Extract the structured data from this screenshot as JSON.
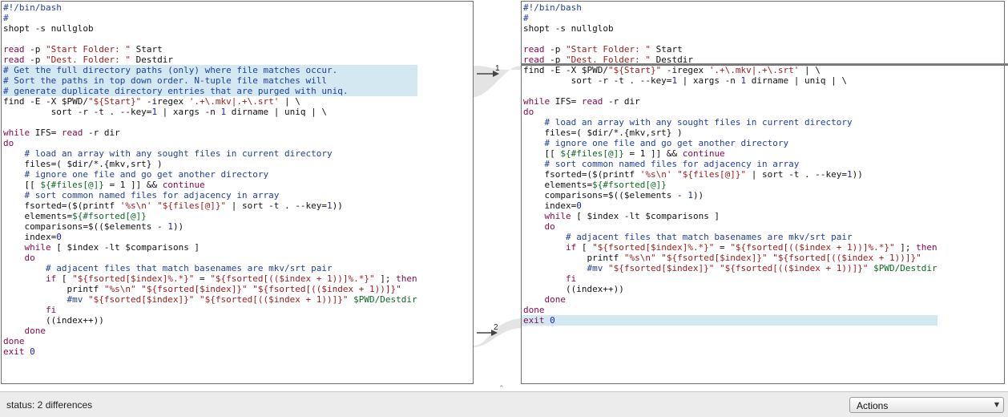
{
  "left": {
    "lines": [
      {
        "hl": false,
        "tokens": [
          {
            "t": "comment",
            "v": "#!/bin/bash"
          }
        ]
      },
      {
        "hl": false,
        "tokens": [
          {
            "t": "comment",
            "v": "#"
          }
        ]
      },
      {
        "hl": false,
        "tokens": [
          {
            "t": "plain",
            "v": "shopt -s nullglob"
          }
        ]
      },
      {
        "hl": false,
        "tokens": []
      },
      {
        "hl": false,
        "tokens": [
          {
            "t": "keyword",
            "v": "read"
          },
          {
            "t": "plain",
            "v": " -p "
          },
          {
            "t": "string",
            "v": "\"Start Folder: \""
          },
          {
            "t": "plain",
            "v": " Start"
          }
        ]
      },
      {
        "hl": false,
        "tokens": [
          {
            "t": "keyword",
            "v": "read"
          },
          {
            "t": "plain",
            "v": " -p "
          },
          {
            "t": "string",
            "v": "\"Dest. Folder: \""
          },
          {
            "t": "plain",
            "v": " Destdir"
          }
        ]
      },
      {
        "hl": true,
        "tokens": [
          {
            "t": "comment",
            "v": "# Get the full directory paths (only) where file matches occur."
          }
        ]
      },
      {
        "hl": true,
        "tokens": [
          {
            "t": "comment",
            "v": "# Sort the paths in top down order. N-tuple file matches will"
          }
        ]
      },
      {
        "hl": true,
        "tokens": [
          {
            "t": "comment",
            "v": "# generate duplicate directory entries that are purged with uniq."
          }
        ]
      },
      {
        "hl": false,
        "tokens": [
          {
            "t": "plain",
            "v": "find -E -X $PWD/"
          },
          {
            "t": "string",
            "v": "\"${Start}\""
          },
          {
            "t": "plain",
            "v": " -iregex "
          },
          {
            "t": "string",
            "v": "'.+\\.mkv|.+\\.srt'"
          },
          {
            "t": "plain",
            "v": " | \\"
          }
        ]
      },
      {
        "hl": false,
        "tokens": [
          {
            "t": "plain",
            "v": "         sort -r -t . --key="
          },
          {
            "t": "num",
            "v": "1"
          },
          {
            "t": "plain",
            "v": " | xargs -n "
          },
          {
            "t": "num",
            "v": "1"
          },
          {
            "t": "plain",
            "v": " dirname | uniq | \\"
          }
        ]
      },
      {
        "hl": false,
        "tokens": []
      },
      {
        "hl": false,
        "tokens": [
          {
            "t": "keyword",
            "v": "while"
          },
          {
            "t": "plain",
            "v": " IFS= "
          },
          {
            "t": "keyword",
            "v": "read"
          },
          {
            "t": "plain",
            "v": " -r dir"
          }
        ]
      },
      {
        "hl": false,
        "tokens": [
          {
            "t": "keyword",
            "v": "do"
          }
        ]
      },
      {
        "hl": false,
        "tokens": [
          {
            "t": "comment",
            "v": "    # load an array with any sought files in current directory"
          }
        ]
      },
      {
        "hl": false,
        "tokens": [
          {
            "t": "plain",
            "v": "    files=( $dir/*.{mkv,srt} )"
          }
        ]
      },
      {
        "hl": false,
        "tokens": [
          {
            "t": "comment",
            "v": "    # ignore one file and go get another directory"
          }
        ]
      },
      {
        "hl": false,
        "tokens": [
          {
            "t": "plain",
            "v": "    [[ "
          },
          {
            "t": "var",
            "v": "${#files[@]}"
          },
          {
            "t": "plain",
            "v": " = 1 ]] && "
          },
          {
            "t": "keyword",
            "v": "continue"
          }
        ]
      },
      {
        "hl": false,
        "tokens": [
          {
            "t": "comment",
            "v": "    # sort common named files for adjacency in array"
          }
        ]
      },
      {
        "hl": false,
        "tokens": [
          {
            "t": "plain",
            "v": "    fsorted=($(printf "
          },
          {
            "t": "string",
            "v": "'%s\\n'"
          },
          {
            "t": "plain",
            "v": " "
          },
          {
            "t": "string",
            "v": "\"${files[@]}\""
          },
          {
            "t": "plain",
            "v": " | sort -t . --key="
          },
          {
            "t": "num",
            "v": "1"
          },
          {
            "t": "plain",
            "v": "))"
          }
        ]
      },
      {
        "hl": false,
        "tokens": [
          {
            "t": "plain",
            "v": "    elements="
          },
          {
            "t": "var",
            "v": "${#fsorted[@]}"
          }
        ]
      },
      {
        "hl": false,
        "tokens": [
          {
            "t": "plain",
            "v": "    comparisons=$(($elements - "
          },
          {
            "t": "num",
            "v": "1"
          },
          {
            "t": "plain",
            "v": "))"
          }
        ]
      },
      {
        "hl": false,
        "tokens": [
          {
            "t": "plain",
            "v": "    index="
          },
          {
            "t": "num",
            "v": "0"
          }
        ]
      },
      {
        "hl": false,
        "tokens": [
          {
            "t": "plain",
            "v": "    "
          },
          {
            "t": "keyword",
            "v": "while"
          },
          {
            "t": "plain",
            "v": " [ $index -lt $comparisons ]"
          }
        ]
      },
      {
        "hl": false,
        "tokens": [
          {
            "t": "plain",
            "v": "    "
          },
          {
            "t": "keyword",
            "v": "do"
          }
        ]
      },
      {
        "hl": false,
        "tokens": [
          {
            "t": "comment",
            "v": "        # adjacent files that match basenames are mkv/srt pair"
          }
        ]
      },
      {
        "hl": false,
        "tokens": [
          {
            "t": "plain",
            "v": "        "
          },
          {
            "t": "keyword",
            "v": "if"
          },
          {
            "t": "plain",
            "v": " [ "
          },
          {
            "t": "string",
            "v": "\"${fsorted[$index]%.*}\""
          },
          {
            "t": "plain",
            "v": " = "
          },
          {
            "t": "string",
            "v": "\"${fsorted[(($index + 1))]%.*}\""
          },
          {
            "t": "plain",
            "v": " ]; "
          },
          {
            "t": "keyword",
            "v": "then"
          }
        ]
      },
      {
        "hl": false,
        "tokens": [
          {
            "t": "plain",
            "v": "            printf "
          },
          {
            "t": "string",
            "v": "\"%s\\n\""
          },
          {
            "t": "plain",
            "v": " "
          },
          {
            "t": "string",
            "v": "\"${fsorted[$index]}\""
          },
          {
            "t": "plain",
            "v": " "
          },
          {
            "t": "string",
            "v": "\"${fsorted[(($index + 1))]}\""
          }
        ]
      },
      {
        "hl": false,
        "tokens": [
          {
            "t": "comment",
            "v": "            #mv "
          },
          {
            "t": "string",
            "v": "\"${fsorted[$index]}\""
          },
          {
            "t": "plain",
            "v": " "
          },
          {
            "t": "string",
            "v": "\"${fsorted[(($index + 1))]}\""
          },
          {
            "t": "plain",
            "v": " "
          },
          {
            "t": "var",
            "v": "$PWD/Destdir"
          }
        ]
      },
      {
        "hl": false,
        "tokens": [
          {
            "t": "keyword",
            "v": "        fi"
          }
        ]
      },
      {
        "hl": false,
        "tokens": [
          {
            "t": "plain",
            "v": "        ((index++))"
          }
        ]
      },
      {
        "hl": false,
        "tokens": [
          {
            "t": "keyword",
            "v": "    done"
          }
        ]
      },
      {
        "hl": false,
        "tokens": [
          {
            "t": "keyword",
            "v": "done"
          }
        ]
      },
      {
        "hl": false,
        "tokens": [
          {
            "t": "keyword",
            "v": "exit"
          },
          {
            "t": "plain",
            "v": " "
          },
          {
            "t": "num",
            "v": "0"
          }
        ]
      }
    ]
  },
  "right": {
    "lines": [
      {
        "hl": false,
        "tokens": [
          {
            "t": "comment",
            "v": "#!/bin/bash"
          }
        ]
      },
      {
        "hl": false,
        "tokens": [
          {
            "t": "comment",
            "v": "#"
          }
        ]
      },
      {
        "hl": false,
        "tokens": [
          {
            "t": "plain",
            "v": "shopt -s nullglob"
          }
        ]
      },
      {
        "hl": false,
        "tokens": []
      },
      {
        "hl": false,
        "tokens": [
          {
            "t": "keyword",
            "v": "read"
          },
          {
            "t": "plain",
            "v": " -p "
          },
          {
            "t": "string",
            "v": "\"Start Folder: \""
          },
          {
            "t": "plain",
            "v": " Start"
          }
        ]
      },
      {
        "hl": false,
        "tokens": [
          {
            "t": "keyword",
            "v": "read"
          },
          {
            "t": "plain",
            "v": " -p "
          },
          {
            "t": "string",
            "v": "\"Dest. Folder: \""
          },
          {
            "t": "plain",
            "v": " Destdir"
          }
        ]
      },
      {
        "hl": false,
        "tokens": [
          {
            "t": "plain",
            "v": "find -E -X $PWD/"
          },
          {
            "t": "string",
            "v": "\"${Start}\""
          },
          {
            "t": "plain",
            "v": " -iregex "
          },
          {
            "t": "string",
            "v": "'.+\\.mkv|.+\\.srt'"
          },
          {
            "t": "plain",
            "v": " | \\"
          }
        ]
      },
      {
        "hl": false,
        "tokens": [
          {
            "t": "plain",
            "v": "         sort -r -t . --key="
          },
          {
            "t": "num",
            "v": "1"
          },
          {
            "t": "plain",
            "v": " | xargs -n "
          },
          {
            "t": "num",
            "v": "1"
          },
          {
            "t": "plain",
            "v": " dirname | uniq | \\"
          }
        ]
      },
      {
        "hl": false,
        "tokens": []
      },
      {
        "hl": false,
        "tokens": [
          {
            "t": "keyword",
            "v": "while"
          },
          {
            "t": "plain",
            "v": " IFS= "
          },
          {
            "t": "keyword",
            "v": "read"
          },
          {
            "t": "plain",
            "v": " -r dir"
          }
        ]
      },
      {
        "hl": false,
        "tokens": [
          {
            "t": "keyword",
            "v": "do"
          }
        ]
      },
      {
        "hl": false,
        "tokens": [
          {
            "t": "comment",
            "v": "    # load an array with any sought files in current directory"
          }
        ]
      },
      {
        "hl": false,
        "tokens": [
          {
            "t": "plain",
            "v": "    files=( $dir/*.{mkv,srt} )"
          }
        ]
      },
      {
        "hl": false,
        "tokens": [
          {
            "t": "comment",
            "v": "    # ignore one file and go get another directory"
          }
        ]
      },
      {
        "hl": false,
        "tokens": [
          {
            "t": "plain",
            "v": "    [[ "
          },
          {
            "t": "var",
            "v": "${#files[@]}"
          },
          {
            "t": "plain",
            "v": " = 1 ]] && "
          },
          {
            "t": "keyword",
            "v": "continue"
          }
        ]
      },
      {
        "hl": false,
        "tokens": [
          {
            "t": "comment",
            "v": "    # sort common named files for adjacency in array"
          }
        ]
      },
      {
        "hl": false,
        "tokens": [
          {
            "t": "plain",
            "v": "    fsorted=($(printf "
          },
          {
            "t": "string",
            "v": "'%s\\n'"
          },
          {
            "t": "plain",
            "v": " "
          },
          {
            "t": "string",
            "v": "\"${files[@]}\""
          },
          {
            "t": "plain",
            "v": " | sort -t . --key="
          },
          {
            "t": "num",
            "v": "1"
          },
          {
            "t": "plain",
            "v": "))"
          }
        ]
      },
      {
        "hl": false,
        "tokens": [
          {
            "t": "plain",
            "v": "    elements="
          },
          {
            "t": "var",
            "v": "${#fsorted[@]}"
          }
        ]
      },
      {
        "hl": false,
        "tokens": [
          {
            "t": "plain",
            "v": "    comparisons=$(($elements - "
          },
          {
            "t": "num",
            "v": "1"
          },
          {
            "t": "plain",
            "v": "))"
          }
        ]
      },
      {
        "hl": false,
        "tokens": [
          {
            "t": "plain",
            "v": "    index="
          },
          {
            "t": "num",
            "v": "0"
          }
        ]
      },
      {
        "hl": false,
        "tokens": [
          {
            "t": "plain",
            "v": "    "
          },
          {
            "t": "keyword",
            "v": "while"
          },
          {
            "t": "plain",
            "v": " [ $index -lt $comparisons ]"
          }
        ]
      },
      {
        "hl": false,
        "tokens": [
          {
            "t": "plain",
            "v": "    "
          },
          {
            "t": "keyword",
            "v": "do"
          }
        ]
      },
      {
        "hl": false,
        "tokens": [
          {
            "t": "comment",
            "v": "        # adjacent files that match basenames are mkv/srt pair"
          }
        ]
      },
      {
        "hl": false,
        "tokens": [
          {
            "t": "plain",
            "v": "        "
          },
          {
            "t": "keyword",
            "v": "if"
          },
          {
            "t": "plain",
            "v": " [ "
          },
          {
            "t": "string",
            "v": "\"${fsorted[$index]%.*}\""
          },
          {
            "t": "plain",
            "v": " = "
          },
          {
            "t": "string",
            "v": "\"${fsorted[(($index + 1))]%.*}\""
          },
          {
            "t": "plain",
            "v": " ]; "
          },
          {
            "t": "keyword",
            "v": "then"
          }
        ]
      },
      {
        "hl": false,
        "tokens": [
          {
            "t": "plain",
            "v": "            printf "
          },
          {
            "t": "string",
            "v": "\"%s\\n\""
          },
          {
            "t": "plain",
            "v": " "
          },
          {
            "t": "string",
            "v": "\"${fsorted[$index]}\""
          },
          {
            "t": "plain",
            "v": " "
          },
          {
            "t": "string",
            "v": "\"${fsorted[(($index + 1))]}\""
          }
        ]
      },
      {
        "hl": false,
        "tokens": [
          {
            "t": "comment",
            "v": "            #mv "
          },
          {
            "t": "string",
            "v": "\"${fsorted[$index]}\""
          },
          {
            "t": "plain",
            "v": " "
          },
          {
            "t": "string",
            "v": "\"${fsorted[(($index + 1))]}\""
          },
          {
            "t": "plain",
            "v": " "
          },
          {
            "t": "var",
            "v": "$PWD/Destdir"
          }
        ]
      },
      {
        "hl": false,
        "tokens": [
          {
            "t": "keyword",
            "v": "        fi"
          }
        ]
      },
      {
        "hl": false,
        "tokens": [
          {
            "t": "plain",
            "v": "        ((index++))"
          }
        ]
      },
      {
        "hl": false,
        "tokens": [
          {
            "t": "keyword",
            "v": "    done"
          }
        ]
      },
      {
        "hl": false,
        "tokens": [
          {
            "t": "keyword",
            "v": "done"
          }
        ]
      },
      {
        "hl": true,
        "tokens": [
          {
            "t": "keyword",
            "v": "exit"
          },
          {
            "t": "plain",
            "v": " "
          },
          {
            "t": "num",
            "v": "0"
          }
        ]
      }
    ]
  },
  "diffs": [
    {
      "label": "1"
    },
    {
      "label": "2"
    }
  ],
  "status": {
    "text": "status: 2 differences"
  },
  "actions": {
    "label": "Actions"
  },
  "colors": {
    "highlight": "#d4e8f1",
    "comment": "#1f3fa0",
    "keyword": "#8b0a50",
    "string": "#9c1a1a",
    "variable": "#0a6b22",
    "number": "#1c1cbf",
    "separator": "#7a7a7a"
  }
}
